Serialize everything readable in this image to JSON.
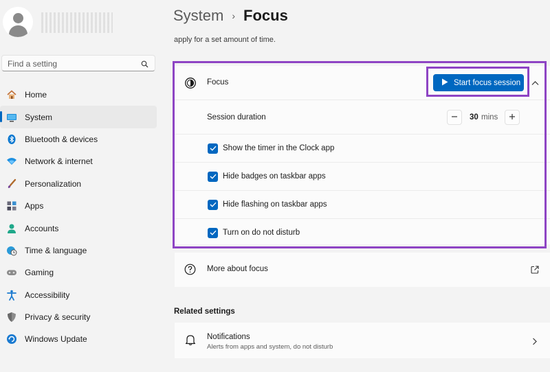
{
  "sidebar": {
    "search_placeholder": "Find a setting",
    "items": [
      {
        "label": "Home",
        "icon": "home-icon"
      },
      {
        "label": "System",
        "icon": "monitor-icon",
        "active": true
      },
      {
        "label": "Bluetooth & devices",
        "icon": "bluetooth-icon"
      },
      {
        "label": "Network & internet",
        "icon": "wifi-icon"
      },
      {
        "label": "Personalization",
        "icon": "brush-icon"
      },
      {
        "label": "Apps",
        "icon": "apps-icon"
      },
      {
        "label": "Accounts",
        "icon": "person-icon"
      },
      {
        "label": "Time & language",
        "icon": "globe-clock-icon"
      },
      {
        "label": "Gaming",
        "icon": "gamepad-icon"
      },
      {
        "label": "Accessibility",
        "icon": "accessibility-icon"
      },
      {
        "label": "Privacy & security",
        "icon": "shield-icon"
      },
      {
        "label": "Windows Update",
        "icon": "update-icon"
      }
    ]
  },
  "header": {
    "parent": "System",
    "separator": "›",
    "current": "Focus",
    "subtext": "apply for a set amount of time."
  },
  "focus": {
    "label": "Focus",
    "start_button": "Start focus session",
    "session_label": "Session duration",
    "session_value": "30",
    "session_unit": "mins",
    "options": [
      {
        "label": "Show the timer in the Clock app",
        "checked": true
      },
      {
        "label": "Hide badges on taskbar apps",
        "checked": true
      },
      {
        "label": "Hide flashing on taskbar apps",
        "checked": true
      },
      {
        "label": "Turn on do not disturb",
        "checked": true
      }
    ]
  },
  "more_about": {
    "label": "More about focus"
  },
  "related": {
    "title": "Related settings",
    "notifications_title": "Notifications",
    "notifications_sub": "Alerts from apps and system, do not disturb"
  },
  "colors": {
    "accent": "#0067c0",
    "highlight": "#8e44c4"
  }
}
